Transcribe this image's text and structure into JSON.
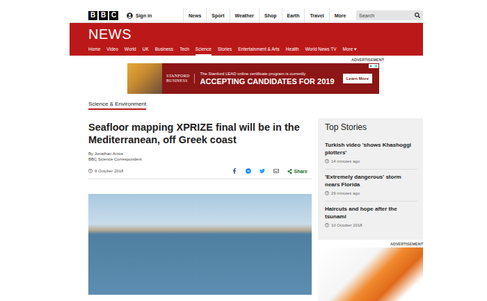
{
  "header": {
    "logo": [
      "B",
      "B",
      "C"
    ],
    "sign_in": "Sign in",
    "nav": [
      "News",
      "Sport",
      "Weather",
      "Shop",
      "Earth",
      "Travel"
    ],
    "more": "More",
    "caret": "▾",
    "search": {
      "placeholder": "Search"
    }
  },
  "masthead": {
    "title": "NEWS",
    "nav": [
      {
        "label": "Home",
        "selected": false
      },
      {
        "label": "Video",
        "selected": false
      },
      {
        "label": "World",
        "selected": false
      },
      {
        "label": "UK",
        "selected": false
      },
      {
        "label": "Business",
        "selected": false
      },
      {
        "label": "Tech",
        "selected": false
      },
      {
        "label": "Science",
        "selected": true
      },
      {
        "label": "Stories",
        "selected": false
      },
      {
        "label": "Entertainment & Arts",
        "selected": false
      },
      {
        "label": "Health",
        "selected": false
      },
      {
        "label": "World News TV",
        "selected": false
      }
    ],
    "more": "More",
    "caret": "▾"
  },
  "top_advertisement": {
    "label": "ADVERTISEMENT",
    "brand": [
      "STANFORD",
      "BUSINESS"
    ],
    "line": "The Stanford LEAD online certificate program is currently",
    "headline": "ACCEPTING CANDIDATES FOR 2019",
    "button": "Learn More"
  },
  "article": {
    "section": "Science & Environment",
    "headline": "Seafloor mapping XPRIZE final will be in the Mediterranean, off Greek coast",
    "author": "By Jonathan Amos",
    "role": "BBC Science Correspondent",
    "date": "9 October 2018",
    "share": "Share"
  },
  "top_stories": {
    "title": "Top Stories",
    "items": [
      {
        "headline": "Turkish video 'shows Khashoggi plotters'",
        "time": "14 minutes ago"
      },
      {
        "headline": "'Extremely dangerous' storm nears Florida",
        "time": "29 minutes ago"
      },
      {
        "headline": "Haircuts and hope after the tsunami",
        "time": "10 October 2018"
      }
    ]
  },
  "side_advertisement": {
    "label": "ADVERTISEMENT"
  }
}
